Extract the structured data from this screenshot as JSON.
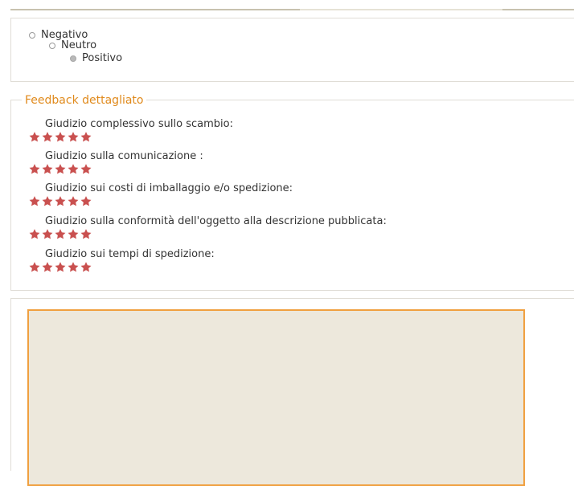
{
  "rating_options": [
    {
      "label": "Negativo",
      "checked": false
    },
    {
      "label": "Neutro",
      "checked": false
    },
    {
      "label": "Positivo",
      "checked": true
    }
  ],
  "detail": {
    "legend": "Feedback dettagliato",
    "star_color": "#c9504f",
    "criteria": [
      {
        "label": "Giudizio complessivo sullo scambio:",
        "stars": 5
      },
      {
        "label": "Giudizio sulla comunicazione :",
        "stars": 5
      },
      {
        "label": "Giudizio sui costi di imballaggio e/o spedizione:",
        "stars": 5
      },
      {
        "label": "Giudizio sulla conformità dell'oggetto alla descrizione pubblicata:",
        "stars": 5
      },
      {
        "label": "Giudizio sui tempi di spedizione:",
        "stars": 5
      }
    ]
  },
  "comment": {
    "value": "",
    "border_color": "#f0a040",
    "background": "#ede8dc"
  }
}
